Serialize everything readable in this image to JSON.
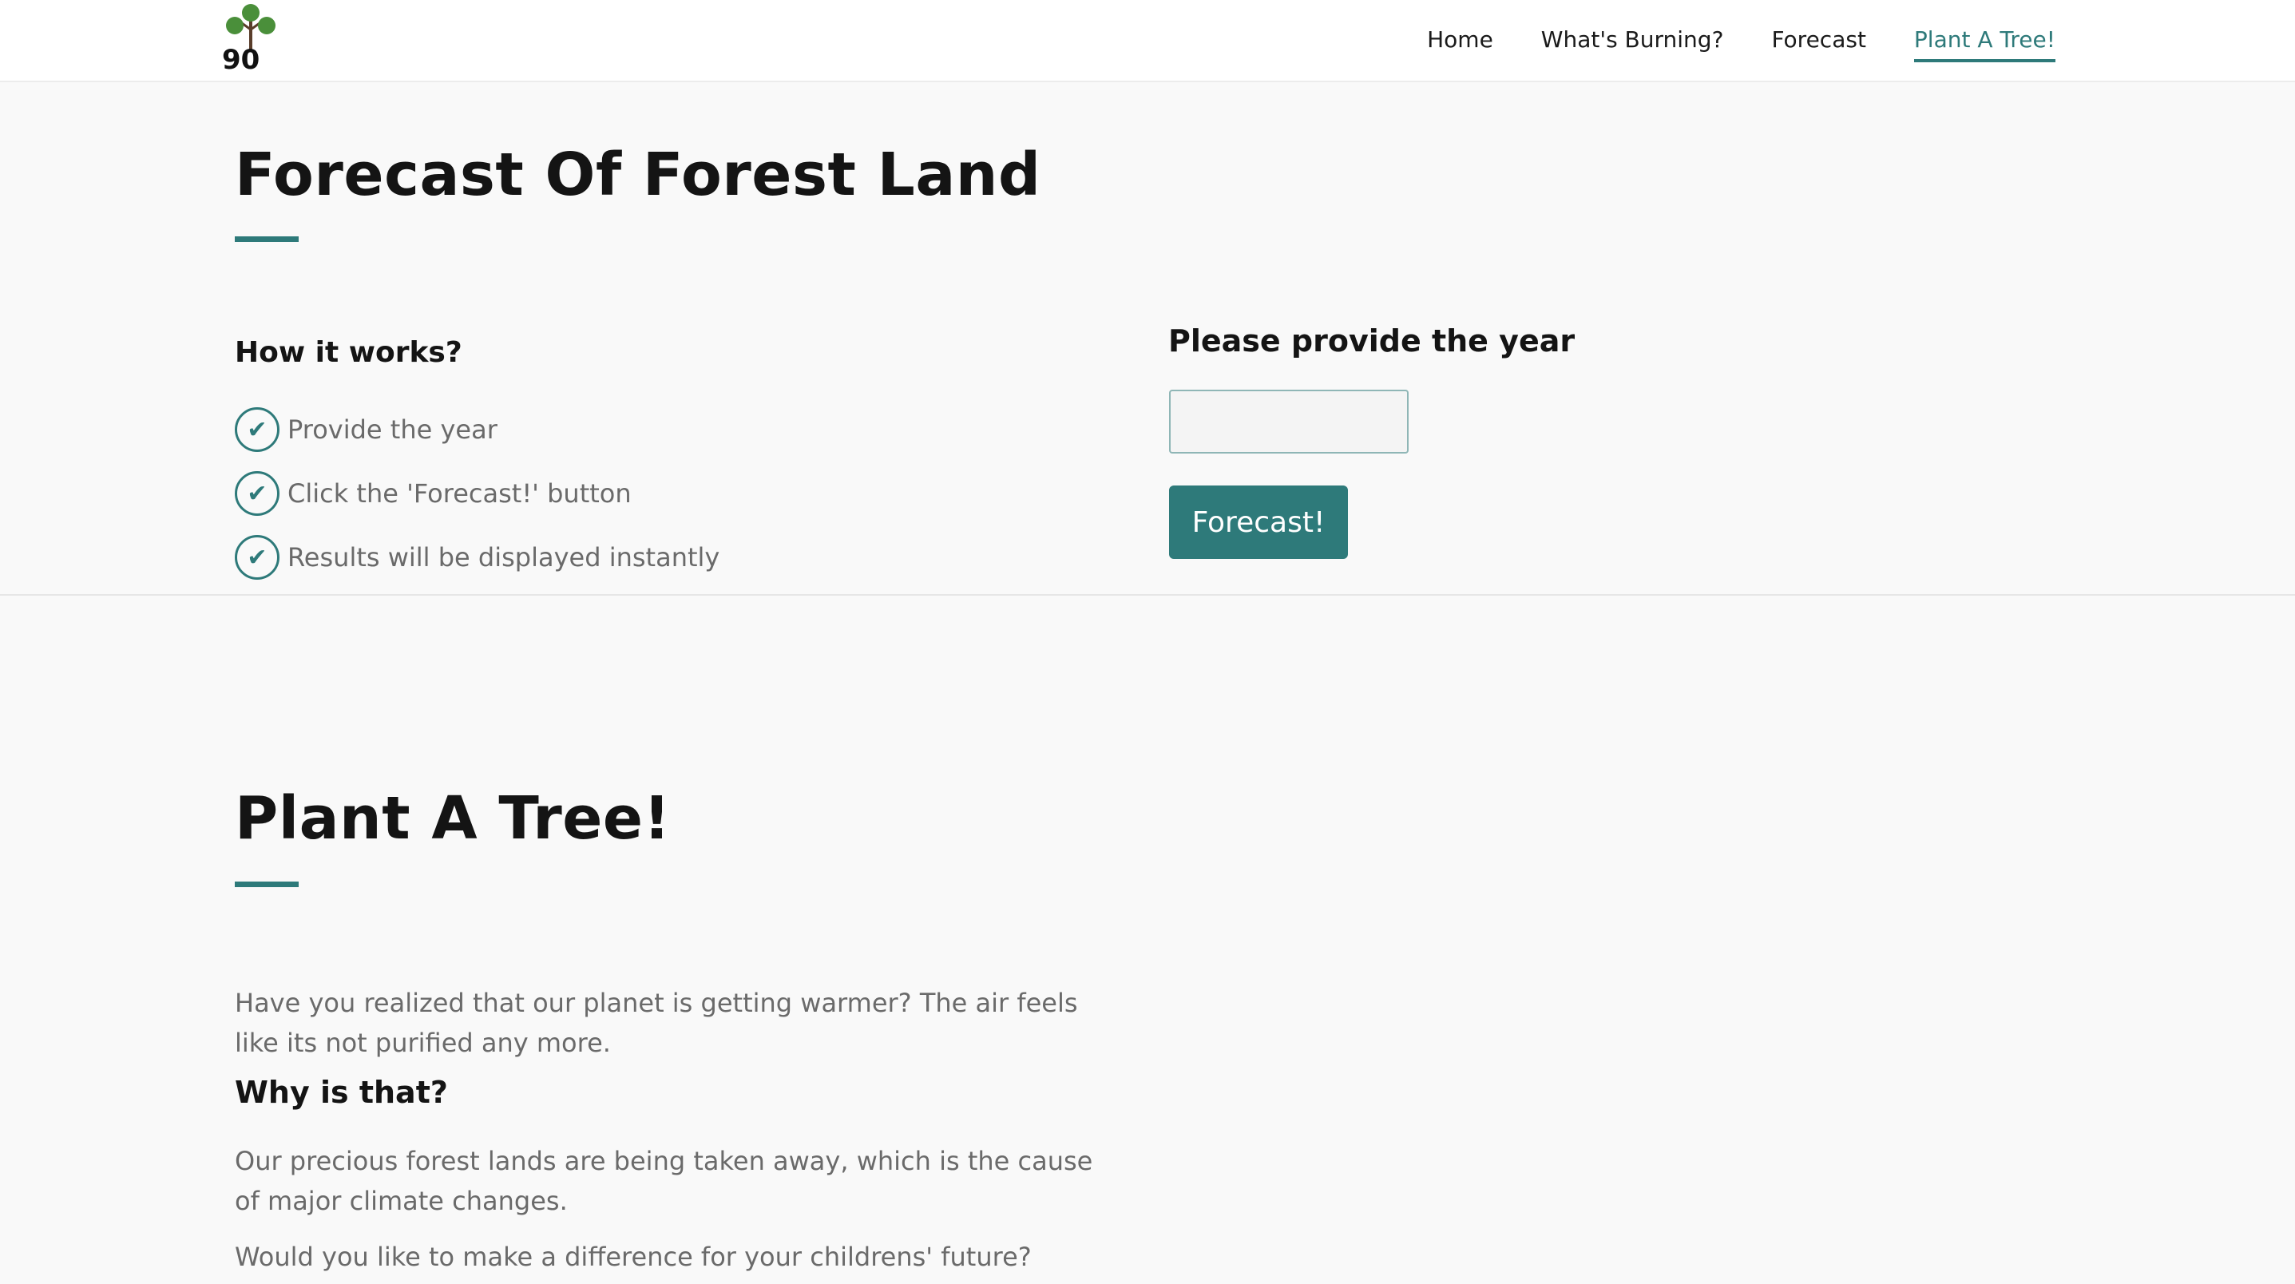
{
  "nav": {
    "items": [
      {
        "label": "Home"
      },
      {
        "label": "What's Burning?"
      },
      {
        "label": "Forecast"
      },
      {
        "label": "Plant A Tree!"
      }
    ],
    "active_index": 3
  },
  "logo": {
    "text": "90"
  },
  "forecast_section": {
    "title": "Forecast Of Forest Land",
    "how_title": "How it works?",
    "steps": [
      {
        "text": "Provide the year"
      },
      {
        "text": "Click the 'Forecast!' button"
      },
      {
        "text": "Results will be displayed instantly"
      }
    ],
    "form_title": "Please provide the year",
    "input_value": "",
    "button_label": "Forecast!"
  },
  "plant_section": {
    "title": "Plant A Tree!",
    "para1": "Have you realized that our planet is getting warmer? The air feels like its not purified any more.",
    "subtitle": "Why is that?",
    "para2": "Our precious forest lands are being taken away, which is the cause of major climate changes.",
    "para3": "Would you like to make a difference for your childrens' future?"
  },
  "colors": {
    "accent": "#2e7a7a",
    "heading": "#141414",
    "body_text": "#6a6a6a",
    "background": "#f9f9f9"
  }
}
